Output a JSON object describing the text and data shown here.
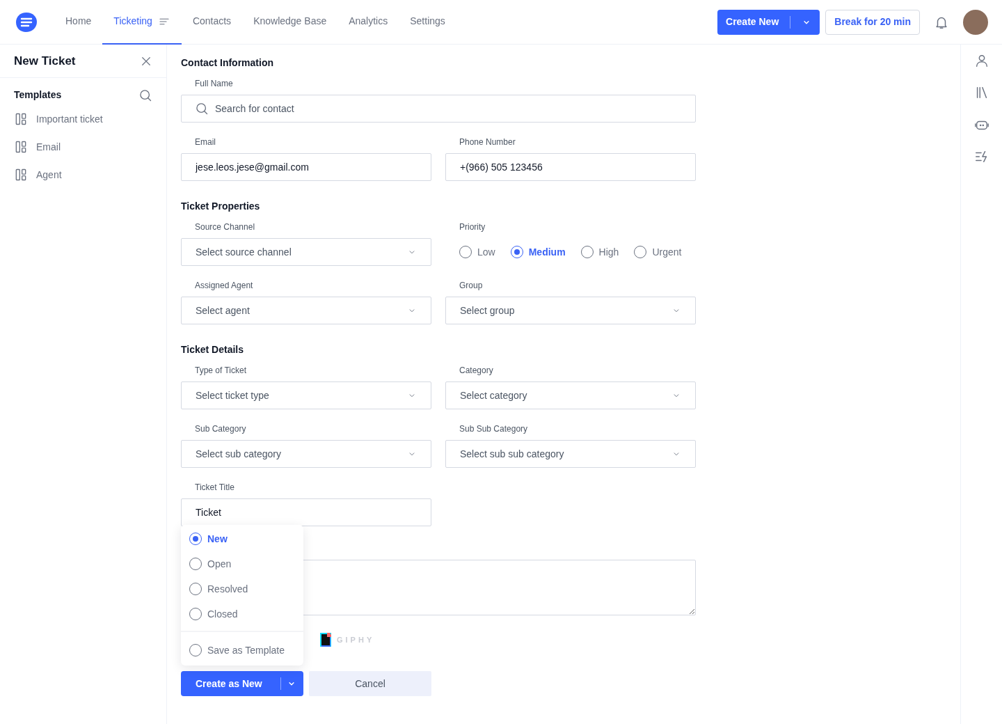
{
  "nav": {
    "items": [
      {
        "label": "Home",
        "selected": false,
        "has_menu": false
      },
      {
        "label": "Ticketing",
        "selected": true,
        "has_menu": true
      },
      {
        "label": "Contacts",
        "selected": false,
        "has_menu": false
      },
      {
        "label": "Knowledge Base",
        "selected": false,
        "has_menu": false
      },
      {
        "label": "Analytics",
        "selected": false,
        "has_menu": false
      },
      {
        "label": "Settings",
        "selected": false,
        "has_menu": false
      }
    ],
    "create_button": "Create New",
    "break_button": "Break for 20 min"
  },
  "sidebar": {
    "title": "New Ticket",
    "templates_heading": "Templates",
    "templates": [
      "Important ticket",
      "Email",
      "Agent"
    ]
  },
  "sections": [
    {
      "title": "Contact Information",
      "fields": [
        {
          "kind": "search",
          "label": "Full Name",
          "placeholder": "Search for contact"
        },
        {
          "kind": "text",
          "label": "Email",
          "value": "jese.leos.jese@gmail.com"
        },
        {
          "kind": "text",
          "label": "Phone Number",
          "value": "+(966) 505 123456"
        }
      ]
    },
    {
      "title": "Ticket Properties",
      "fields": [
        {
          "kind": "select",
          "label": "Source Channel",
          "placeholder": "Select source channel"
        },
        {
          "kind": "radio",
          "label": "Priority",
          "options": [
            {
              "label": "Low",
              "selected": false
            },
            {
              "label": "Medium",
              "selected": true
            },
            {
              "label": "High",
              "selected": false
            },
            {
              "label": "Urgent",
              "selected": false
            }
          ]
        },
        {
          "kind": "select",
          "label": "Assigned Agent",
          "placeholder": "Select agent"
        },
        {
          "kind": "select",
          "label": "Group",
          "placeholder": "Select group"
        }
      ]
    },
    {
      "title": "Ticket Details",
      "fields": [
        {
          "kind": "select",
          "label": "Type of Ticket",
          "placeholder": "Select ticket type"
        },
        {
          "kind": "select",
          "label": "Category",
          "placeholder": "Select category"
        },
        {
          "kind": "select",
          "label": "Sub Category",
          "placeholder": "Select sub category"
        },
        {
          "kind": "select",
          "label": "Sub Sub Category",
          "placeholder": "Select sub sub category"
        },
        {
          "kind": "text",
          "label": "Ticket Title",
          "value": "Ticket"
        },
        {
          "kind": "textarea"
        }
      ]
    }
  ],
  "toolbar": {
    "giphy": "GIPHY"
  },
  "status_menu": {
    "options": [
      {
        "label": "New",
        "selected": true
      },
      {
        "label": "Open",
        "selected": false
      },
      {
        "label": "Resolved",
        "selected": false
      },
      {
        "label": "Closed",
        "selected": false
      }
    ],
    "template_option": {
      "label": "Save as Template",
      "selected": false
    }
  },
  "footer": {
    "submit": "Create as New",
    "cancel": "Cancel"
  }
}
